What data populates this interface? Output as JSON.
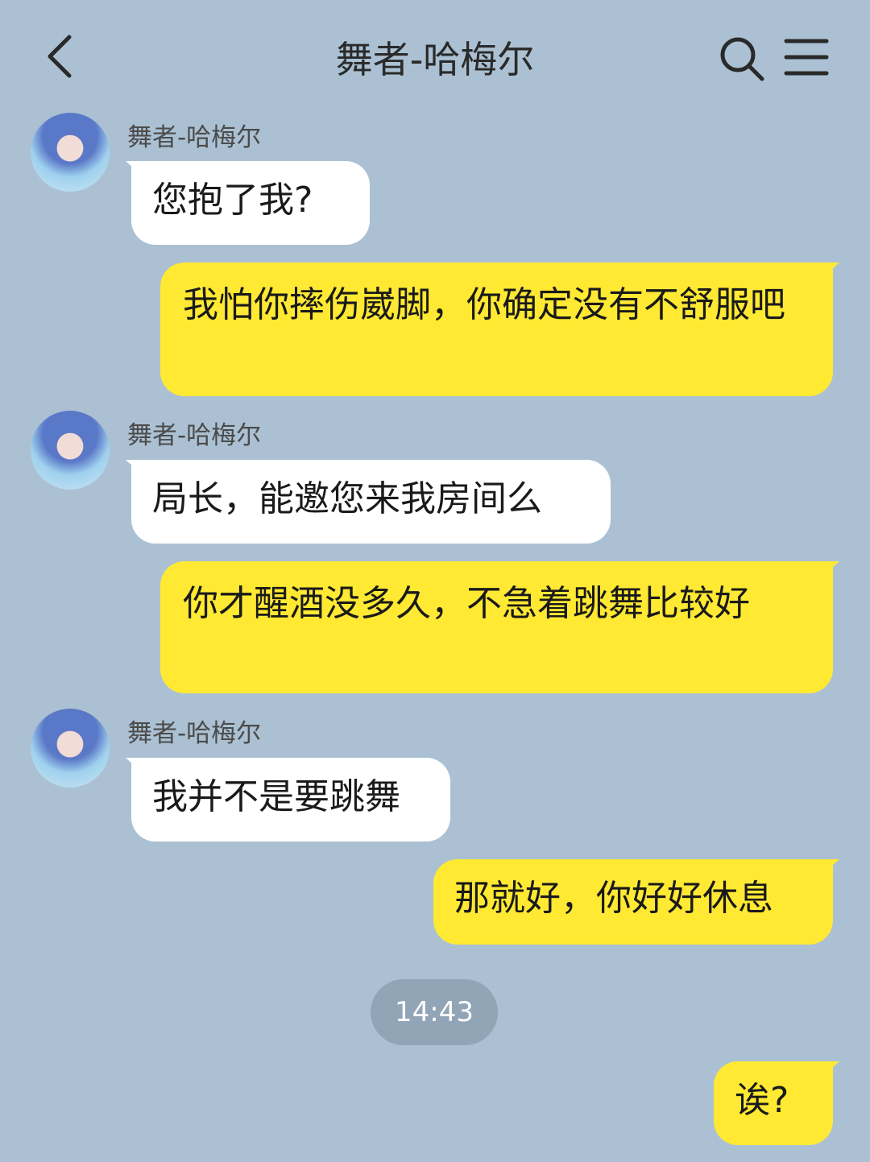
{
  "header": {
    "title": "舞者-哈梅尔"
  },
  "messages": [
    {
      "side": "in",
      "sender": "舞者-哈梅尔",
      "text": "您抱了我?"
    },
    {
      "side": "out",
      "text": "我怕你摔伤崴脚，你确定没有不舒服吧"
    },
    {
      "side": "in",
      "sender": "舞者-哈梅尔",
      "text": "局长，能邀您来我房间么"
    },
    {
      "side": "out",
      "text": "你才醒酒没多久，不急着跳舞比较好"
    },
    {
      "side": "in",
      "sender": "舞者-哈梅尔",
      "text": "我并不是要跳舞"
    },
    {
      "side": "out",
      "text": "那就好，你好好休息"
    },
    {
      "side": "out",
      "text": "诶?"
    }
  ],
  "timestamp": "14:43",
  "colors": {
    "background": "#abc1d3",
    "incoming_bubble": "#ffffff",
    "outgoing_bubble": "#ffe933",
    "time_pill": "#91a5b6"
  }
}
